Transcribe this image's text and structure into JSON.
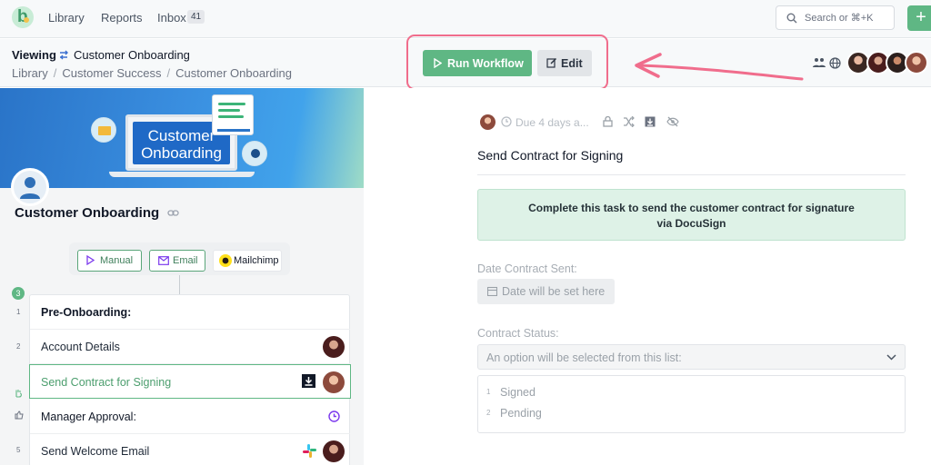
{
  "nav": {
    "links": [
      "Library",
      "Reports",
      "Inbox"
    ],
    "inbox_count": "41",
    "search_placeholder": "Search or ⌘+K",
    "new_button": "+"
  },
  "header": {
    "viewing_label": "Viewing",
    "workflow_name": "Customer Onboarding",
    "breadcrumbs": [
      "Library",
      "Customer Success",
      "Customer Onboarding"
    ],
    "run_button": "Run Workflow",
    "edit_button": "Edit"
  },
  "workflow": {
    "banner_text_line1": "Customer",
    "banner_text_line2": "Onboarding",
    "title": "Customer Onboarding",
    "triggers": [
      "Manual",
      "Email",
      "Mailchimp"
    ],
    "steps": [
      {
        "num": "1",
        "label": "Pre-Onboarding:"
      },
      {
        "num": "2",
        "label": "Account Details"
      },
      {
        "num": "3",
        "label": "Send Contract for Signing"
      },
      {
        "num": "",
        "label": "Manager Approval:"
      },
      {
        "num": "5",
        "label": "Send Welcome Email"
      }
    ]
  },
  "task": {
    "due": "Due 4 days a...",
    "title": "Send Contract for Signing",
    "notice_line1": "Complete this task to send the customer contract for signature",
    "notice_line2": "via DocuSign",
    "date_label": "Date Contract Sent:",
    "date_placeholder": "Date will be set here",
    "status_label": "Contract Status:",
    "status_placeholder": "An option will be selected from this list:",
    "options": [
      {
        "num": "1",
        "label": "Signed"
      },
      {
        "num": "2",
        "label": "Pending"
      }
    ]
  },
  "colors": {
    "accent_green": "#5fb784",
    "highlight_pink": "#f06d8c"
  }
}
